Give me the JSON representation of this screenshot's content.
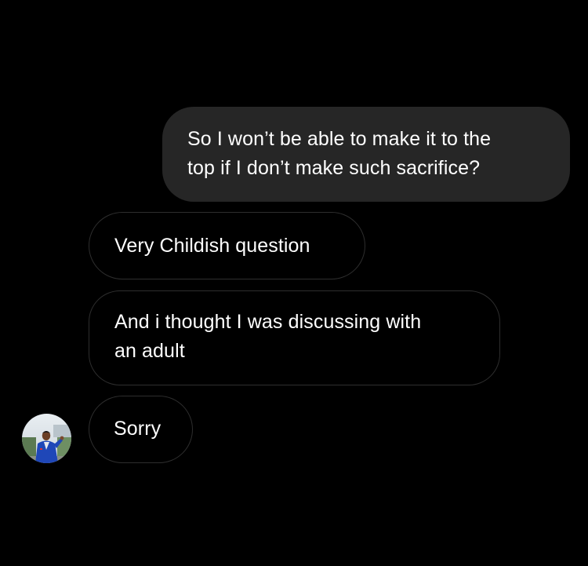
{
  "conversation": {
    "messages": [
      {
        "direction": "outgoing",
        "text": "So I won’t be able to make it to the\ntop if I don’t make such sacrifice?"
      },
      {
        "direction": "incoming",
        "text": "Very Childish question"
      },
      {
        "direction": "incoming",
        "text": "And i thought I was discussing with\nan adult"
      },
      {
        "direction": "incoming",
        "text": "Sorry"
      }
    ]
  },
  "colors": {
    "background": "#000000",
    "outgoing_bubble": "#262626",
    "incoming_border": "#2e2e2e",
    "text": "#ffffff"
  },
  "icons": {
    "avatar": "sender-avatar-photo"
  }
}
